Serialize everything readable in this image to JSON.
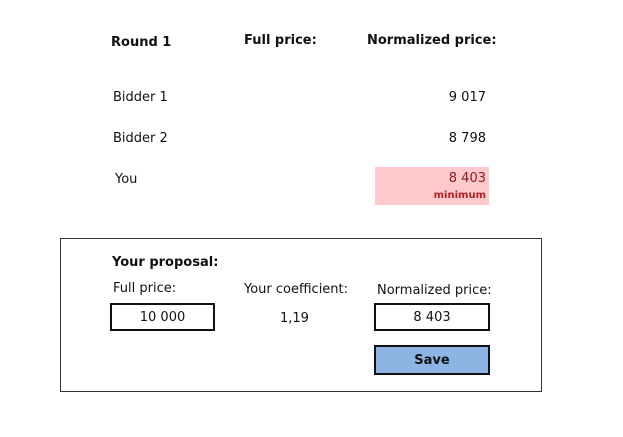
{
  "header": {
    "round": "Round 1",
    "full_price": "Full price:",
    "normalized_price": "Normalized price:"
  },
  "bids": [
    {
      "name": "Bidder 1",
      "normalized": "9 017"
    },
    {
      "name": "Bidder 2",
      "normalized": "8 798"
    },
    {
      "name": "You",
      "normalized": "8 403",
      "badge": "minimum"
    }
  ],
  "proposal": {
    "title": "Your proposal:",
    "full_price_label": "Full price:",
    "full_price_value": "10 000",
    "coefficient_label": "Your coefficient:",
    "coefficient_value": "1,19",
    "normalized_label": "Normalized price:",
    "normalized_value": "8 403",
    "save_label": "Save"
  },
  "colors": {
    "minimum_highlight": "#ffc8cc",
    "minimum_text": "#b22222",
    "save_button": "#8eb4e3"
  }
}
